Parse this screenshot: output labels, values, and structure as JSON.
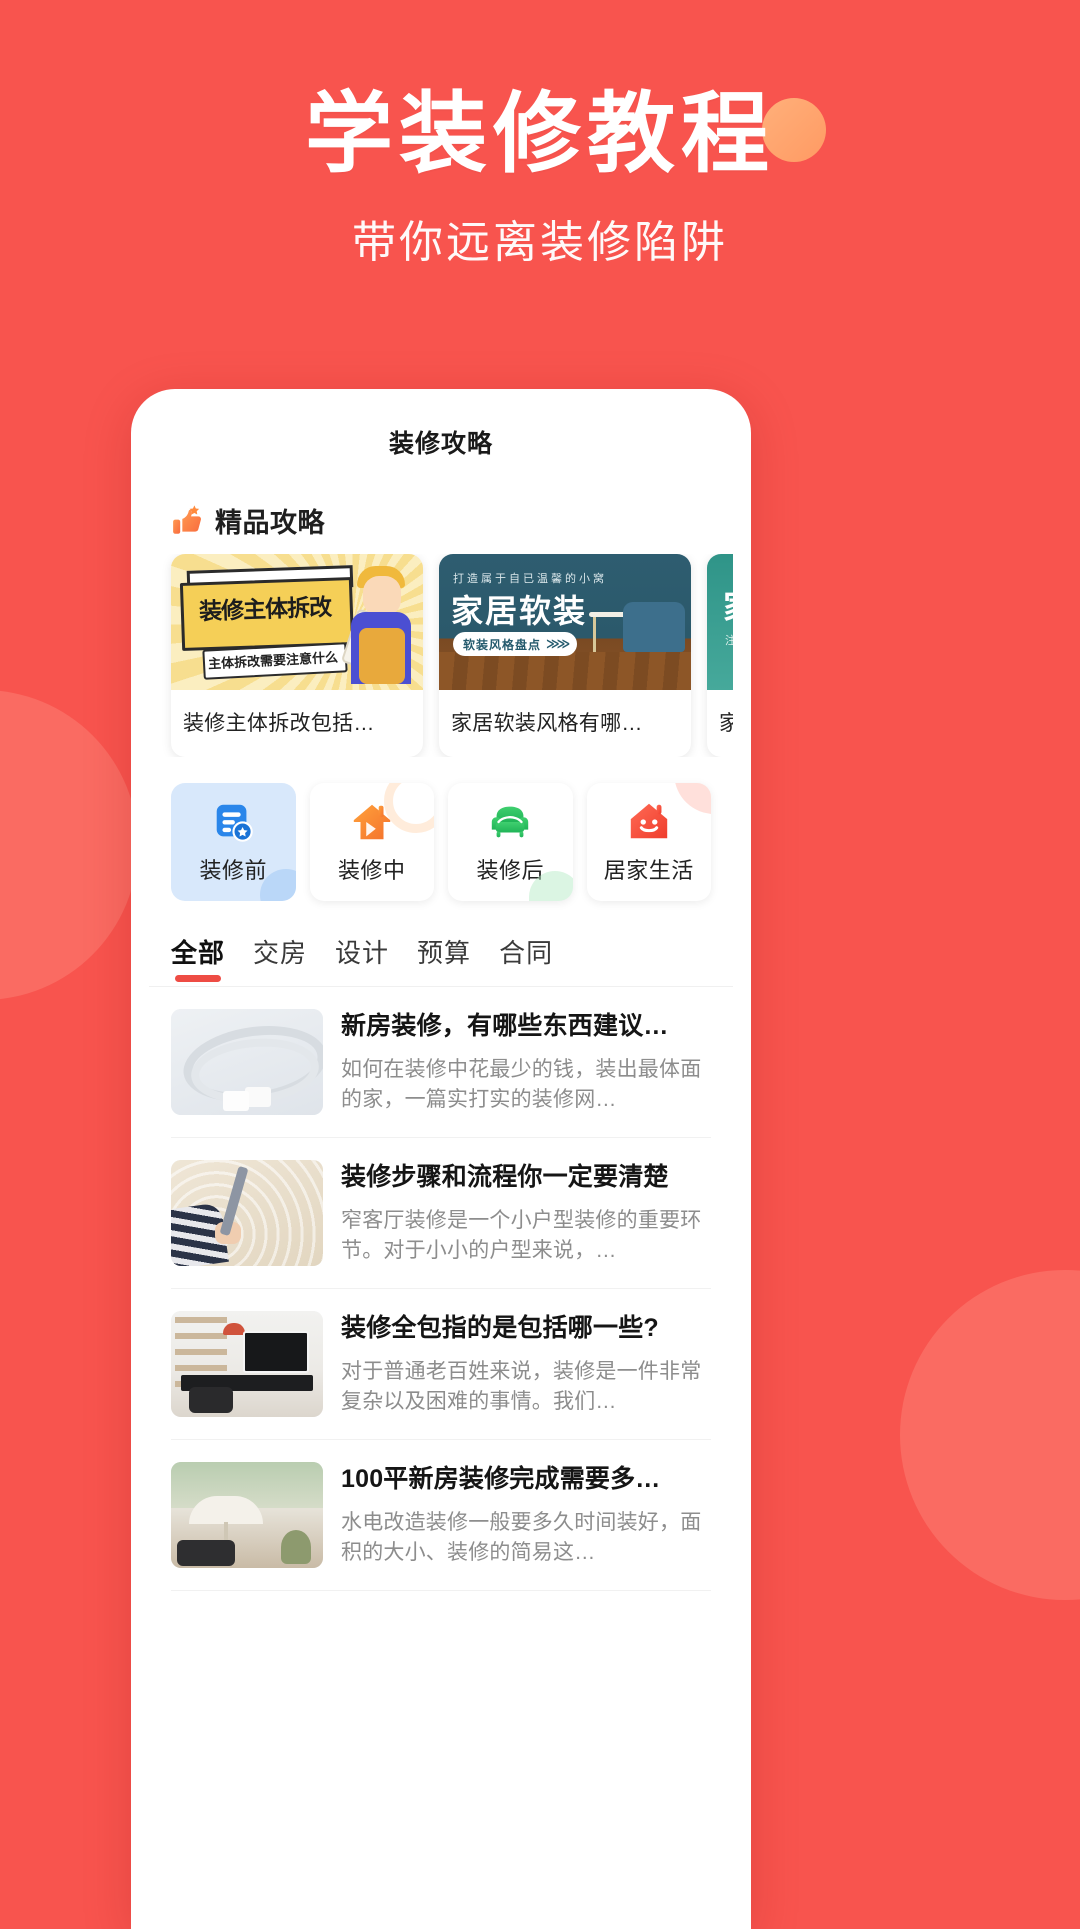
{
  "hero": {
    "title": "学装修教程",
    "subtitle": "带你远离装修陷阱"
  },
  "colors": {
    "background": "#f8544e",
    "accent": "#ee4c44",
    "selected_tile": "#d8e8fb"
  },
  "phone": {
    "appbar": {
      "title": "装修攻略"
    },
    "featured_section": {
      "icon": "thumbs-up-icon",
      "title": "精品攻略",
      "cards": [
        {
          "title": "装修主体拆改包括…",
          "art_main": "装修主体拆改",
          "art_sub": "主体拆改需要注意什么"
        },
        {
          "title": "家居软装风格有哪…",
          "art_kicker": "打造属于自已温馨的小窝",
          "art_main": "家居软装",
          "art_pill": "软装风格盘点",
          "art_pill_arrow": "≫≫"
        },
        {
          "title": "家居",
          "art_main": "家居",
          "art_sub": "注意事"
        }
      ]
    },
    "categories": [
      {
        "label": "装修前",
        "icon": "document-star-icon",
        "selected": true
      },
      {
        "label": "装修中",
        "icon": "house-hammer-icon",
        "selected": false
      },
      {
        "label": "装修后",
        "icon": "sofa-icon",
        "selected": false
      },
      {
        "label": "居家生活",
        "icon": "smiley-house-icon",
        "selected": false
      }
    ],
    "tabs": [
      {
        "label": "全部",
        "active": true
      },
      {
        "label": "交房",
        "active": false
      },
      {
        "label": "设计",
        "active": false
      },
      {
        "label": "预算",
        "active": false
      },
      {
        "label": "合同",
        "active": false
      }
    ],
    "articles": [
      {
        "title": "新房装修，有哪些东西建议…",
        "desc": "如何在装修中花最少的钱，装出最体面的家，一篇实打实的装修网…",
        "thumb": "cable-photo"
      },
      {
        "title": "装修步骤和流程你一定要清楚",
        "desc": "窄客厅装修是一个小户型装修的重要环节。对于小小的户型来说，…",
        "thumb": "wall-plastering-photo"
      },
      {
        "title": "装修全包指的是包括哪一些?",
        "desc": "对于普通老百姓来说，装修是一件非常复杂以及困难的事情。我们…",
        "thumb": "living-room-photo"
      },
      {
        "title": "100平新房装修完成需要多…",
        "desc": "水电改造装修一般要多久时间装好，面积的大小、装修的简易这…",
        "thumb": "garden-terrace-photo"
      }
    ]
  }
}
